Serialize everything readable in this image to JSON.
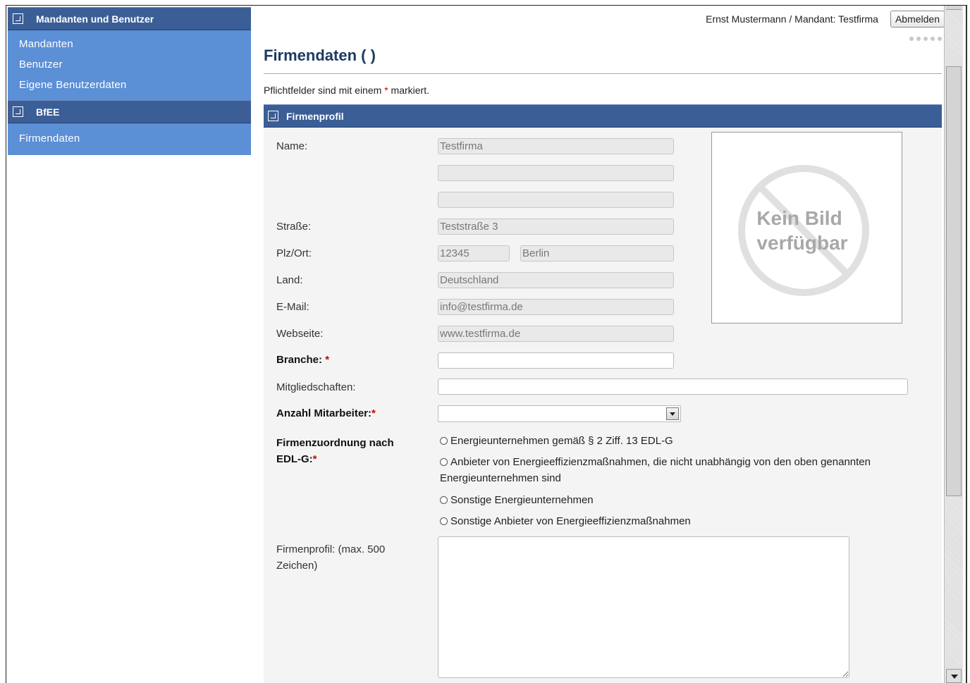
{
  "sidebar": {
    "sections": [
      {
        "title": "Mandanten und Benutzer",
        "items": [
          "Mandanten",
          "Benutzer",
          "Eigene Benutzerdaten"
        ]
      },
      {
        "title": "BfEE",
        "items": [
          "Firmendaten"
        ]
      }
    ]
  },
  "header": {
    "user_text": "Ernst Mustermann / Mandant: Testfirma",
    "logout_label": "Abmelden"
  },
  "page": {
    "title": "Firmendaten (  )",
    "required_note_pre": "Pflichtfelder sind mit einem ",
    "required_star": "*",
    "required_note_post": " markiert."
  },
  "section": {
    "title": "Firmenprofil"
  },
  "form": {
    "name_label": "Name:",
    "name_value": "Testfirma",
    "name2_value": "",
    "name3_value": "",
    "street_label": "Straße:",
    "street_value": "Teststraße 3",
    "zipcity_label": "Plz/Ort:",
    "zip_value": "12345",
    "city_value": "Berlin",
    "country_label": "Land:",
    "country_value": "Deutschland",
    "email_label": "E-Mail:",
    "email_value": "info@testfirma.de",
    "website_label": "Webseite:",
    "website_value": "www.testfirma.de",
    "industry_label": "Branche:",
    "industry_value": "",
    "memberships_label": "Mitgliedschaften:",
    "memberships_value": "",
    "employees_label": "Anzahl Mitarbeiter:",
    "employees_value": "",
    "assignment_label_1": "Firmenzuordnung nach",
    "assignment_label_2": "EDL-G:",
    "assignment_options": [
      "Energieunternehmen gemäß § 2 Ziff. 13 EDL-G",
      "Anbieter von Energieeffizienzmaßnahmen, die nicht unabhängig von den oben genannten",
      "Sonstige Energieunternehmen",
      "Sonstige Anbieter von Energieeffizienzmaßnahmen"
    ],
    "assignment_option_2_cont": "Energieunternehmen sind",
    "profile_label_1": "Firmenprofil: (max. 500",
    "profile_label_2": "Zeichen)",
    "profile_value": ""
  },
  "no_image": {
    "line1": "Kein Bild",
    "line2": "verfügbar"
  },
  "star": "*"
}
